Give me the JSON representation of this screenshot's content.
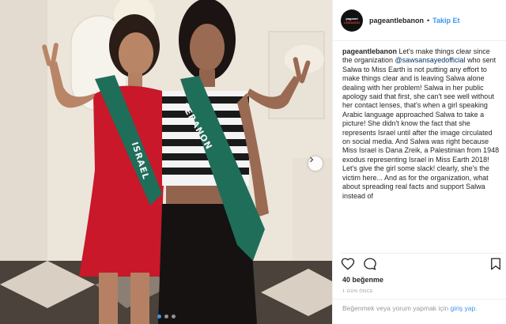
{
  "post": {
    "sash_left": "ISRAEL",
    "sash_right": "LEBANON",
    "carousel": {
      "count": 3,
      "active": 1
    }
  },
  "header": {
    "username": "pageantlebanon",
    "separator": "•",
    "follow_label": "Takip Et",
    "avatar_text_top": "pageant",
    "avatar_text_bottom": "LEBANON"
  },
  "caption": {
    "username": "pageantlebanon",
    "text_before_mention": " Let's make things clear since the organization ",
    "mention": "@sawsansayedofficial",
    "text_after_mention": " who sent Salwa to Miss Earth is not putting any effort to make things clear and is leaving Salwa alone dealing with her problem! Salwa in her public apology said that first, she can't see well without her contact lenses, that's when a girl speaking Arabic language approached Salwa to take a picture! She didn't know the fact that she represents Israel until after the image circulated on social media. And Salwa was right because Miss Israel is Dana Zreik, a Palestinian from 1948 exodus representing Israel in Miss Earth 2018!",
    "text_second_para": "Let's give the girl some slack! clearly, she's the victim here... And as for the organization, what about spreading real facts and support Salwa instead of"
  },
  "actions": {
    "like_icon": "heart-icon",
    "comment_icon": "comment-icon",
    "save_icon": "bookmark-icon"
  },
  "likes": "40 beğenme",
  "time": "1 GÜN ÖNCE",
  "comment_box": {
    "text": "Beğenmek veya yorum yapmak için ",
    "link": "giriş yap",
    "end": "."
  },
  "colors": {
    "accent": "#3897f0",
    "sash_green": "#1f6e5a",
    "red_dress": "#c8182a"
  }
}
